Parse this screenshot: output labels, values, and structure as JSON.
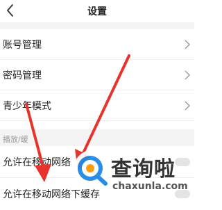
{
  "header": {
    "title": "设置"
  },
  "settings": {
    "items": [
      {
        "label": "账号管理"
      },
      {
        "label": "密码管理"
      },
      {
        "label": "青少年模式"
      }
    ]
  },
  "playback": {
    "section_label": "播放/缓",
    "rows": [
      {
        "label": "允许在移动网络"
      },
      {
        "label": "允许在移动网络下缓存"
      }
    ]
  },
  "watermark": {
    "cn": "查询啦",
    "en": "chaxunla.com"
  },
  "colors": {
    "annotation_arrow": "#e8332c",
    "divider": "#eeeeee"
  }
}
